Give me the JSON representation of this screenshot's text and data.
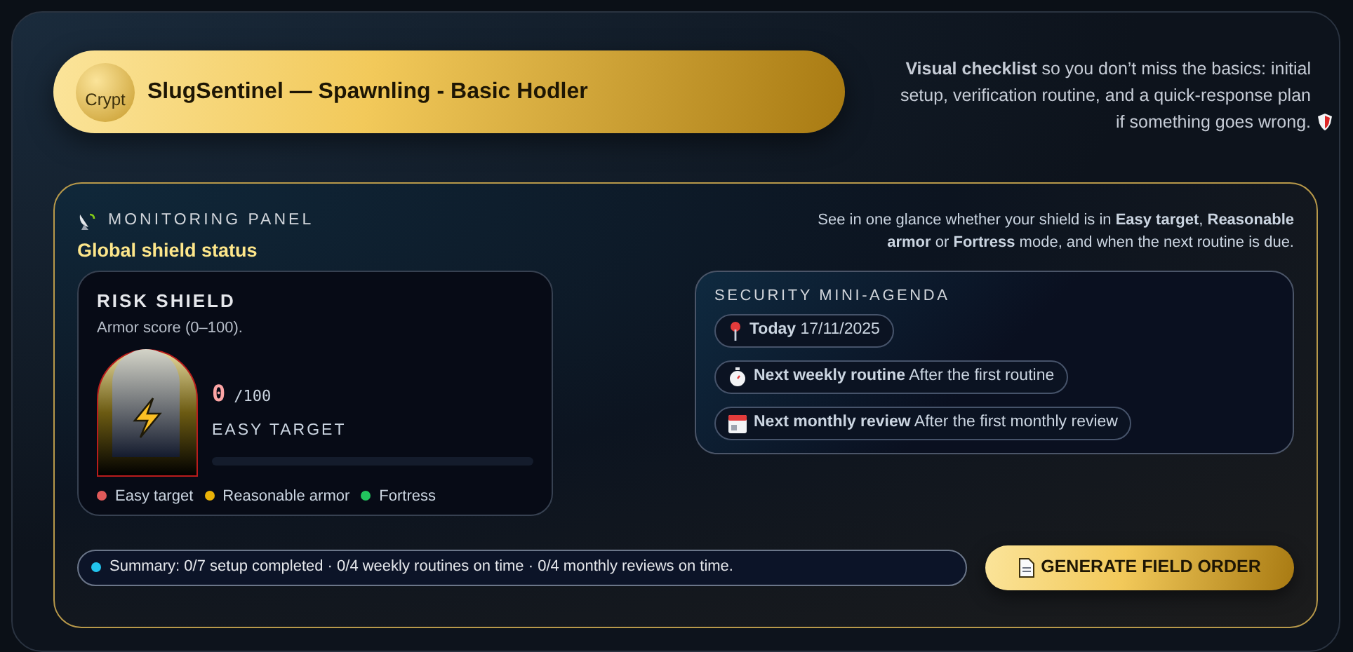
{
  "header": {
    "avatar_alt": "Crypt",
    "title": "SlugSentinel — Spawnling - Basic Hodler"
  },
  "intro": "**Visual checklist** so you don’t miss the basics: initial setup, verification routine, and a quick-response plan if something goes wrong.",
  "panel": {
    "eyebrow": "MONITORING PANEL",
    "title": "Global shield status",
    "description": "See in one glance whether your shield is in **Easy target**, **Reasonable armor** or **Fortress** mode, and when the next routine is due.",
    "risk": {
      "title": "RISK SHIELD",
      "subtitle": "Armor score (0–100).",
      "score": "0",
      "max": "/100",
      "mode": "EASY TARGET",
      "level": 0,
      "legend": [
        {
          "label": "Easy target",
          "color": "#e05a5a"
        },
        {
          "label": "Reasonable armor",
          "color": "#eab308"
        },
        {
          "label": "Fortress",
          "color": "#22c55e"
        }
      ]
    },
    "agenda": {
      "title": "SECURITY MINI-AGENDA",
      "items": [
        {
          "kind": "pin",
          "text": "**Today** 17/11/2025"
        },
        {
          "kind": "stopwatch",
          "text": "**Next weekly routine** After the first routine"
        },
        {
          "kind": "calendar",
          "text": "**Next monthly review** After the first monthly review"
        }
      ]
    },
    "summary": "Summary: 0/7 setup completed · 0/4 weekly routines on time · 0/4 monthly reviews on time.",
    "button": "GENERATE FIELD ORDER"
  }
}
